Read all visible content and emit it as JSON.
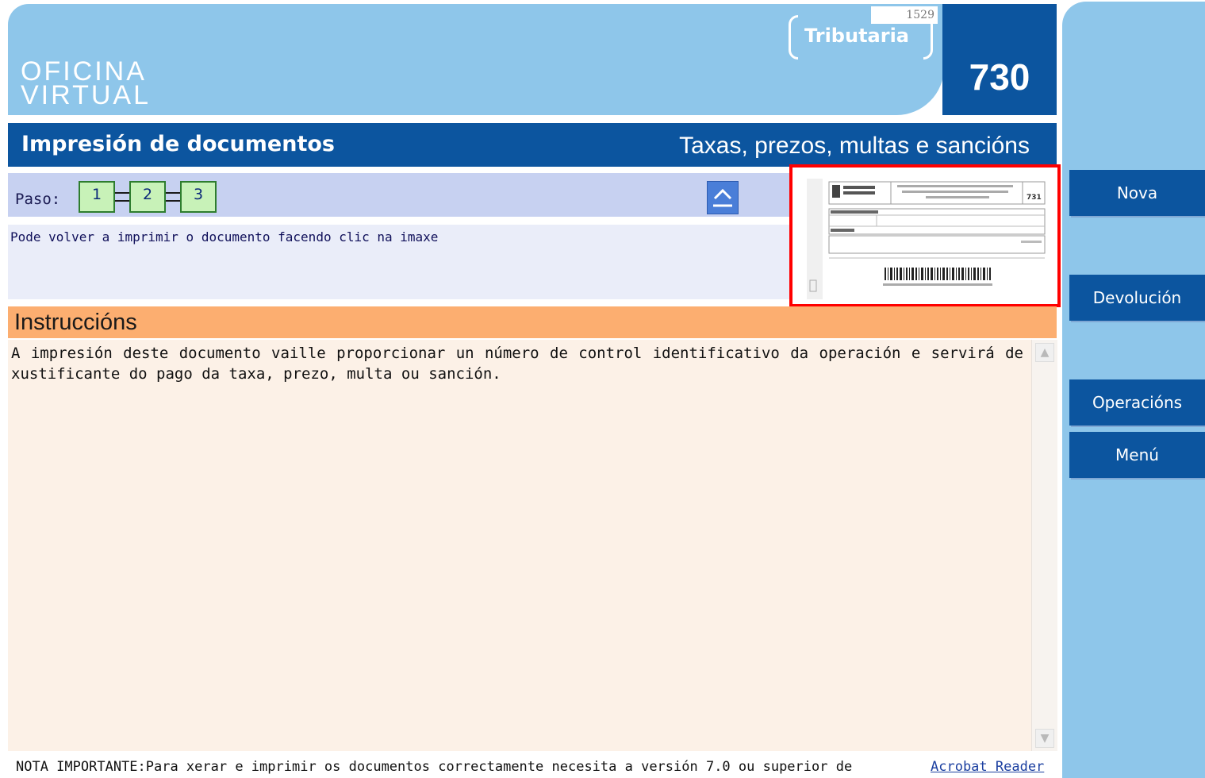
{
  "header": {
    "brand_line1": "OFICINA",
    "brand_line2": "VIRTUAL",
    "tributaria": "Tributaria",
    "small_code": "1529",
    "form_code": "730"
  },
  "titlebar": {
    "title": "Impresión de documentos",
    "subtitle": "Taxas, prezos, multas e sancións"
  },
  "steps": {
    "label": "Paso:",
    "items": [
      "1",
      "2",
      "3"
    ]
  },
  "info": {
    "text": "Pode volver a imprimir o documento facendo clic na imaxe"
  },
  "thumbnail": {
    "doc_code": "731"
  },
  "instructions": {
    "heading": "Instruccións",
    "body": "A impresión deste documento vaille proporcionar un número de control identificativo da operación e servirá de xustificante do pago da taxa, prezo, multa ou sanción."
  },
  "footer": {
    "note": "NOTA IMPORTANTE:Para xerar e imprimir os documentos correctamente necesita a versión 7.0 ou superior de",
    "link": "Acrobat Reader"
  },
  "sidebar": {
    "buttons": [
      "Nova",
      "Devolución",
      "Operacións",
      "Menú"
    ]
  },
  "colors": {
    "header_light": "#8ec6ea",
    "primary_dark": "#0c559f",
    "instructions_orange": "#fcae70",
    "highlight_red": "#ff0000"
  }
}
